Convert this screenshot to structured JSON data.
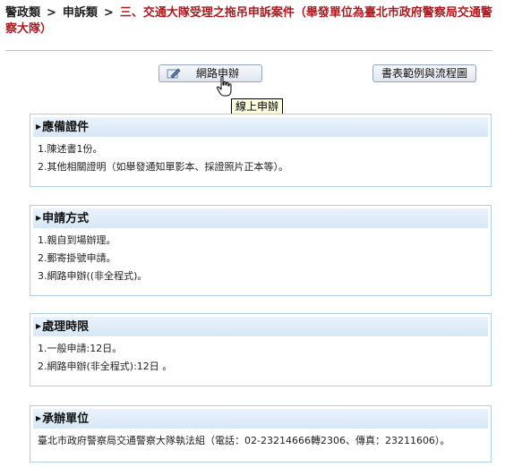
{
  "breadcrumb": {
    "level1": "警政類",
    "level2": "申訴類",
    "separator": ">",
    "current": "三、交通大隊受理之拖吊申訴案件（舉發單位為臺北市政府警察局交通警察大隊）"
  },
  "buttons": {
    "online_apply": "網路申辦",
    "forms_and_flow": "書表範例與流程圖"
  },
  "tooltip": "線上申辦",
  "sections": [
    {
      "title": "應備證件",
      "lines": [
        "1.陳述書1份。",
        "2.其他相關證明（如舉發通知單影本、採證照片正本等）。"
      ]
    },
    {
      "title": "申請方式",
      "lines": [
        "1.親自到場辦理。",
        "2.郵寄掛號申請。",
        "3.網路申辦((非全程式)。"
      ]
    },
    {
      "title": "處理時限",
      "lines": [
        "1.一般申請:12日。",
        "2.網路申辦(非全程式):12日 。"
      ]
    },
    {
      "title": "承辦單位",
      "lines": [
        "臺北市政府警察局交通警察大隊執法組（電話：02-23214666轉2306、傳真：23211606）。"
      ]
    }
  ],
  "colors": {
    "current_crumb": "#b0181e",
    "box_border": "#aed0e6",
    "box_header_bg": "#d6e7f5"
  },
  "icons": {
    "online_button_icon": "pen-icon",
    "pointer": "hand-cursor-icon",
    "section_marker": "triangle-right-icon"
  }
}
